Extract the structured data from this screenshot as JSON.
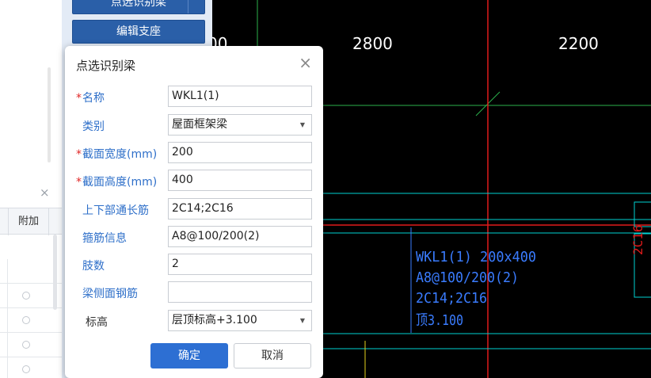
{
  "side_panel": {
    "top_button_label": "点选识别梁",
    "edit_support_label": "编辑支座"
  },
  "left_table": {
    "close_glyph": "×",
    "column_header": "附加"
  },
  "cad": {
    "dim_partial": "00",
    "dims": [
      "2800",
      "2200"
    ],
    "annotation_lines": [
      "WKL1(1) 200x400",
      "A8@100/200(2)",
      "2C14;2C16",
      "顶3.100"
    ],
    "vertical_text": "2C16"
  },
  "dialog": {
    "title": "点选识别梁",
    "close_glyph": "×",
    "required_mark": "*",
    "fields": {
      "name": {
        "label": "名称",
        "value": "WKL1(1)"
      },
      "category": {
        "label": "类别",
        "value": "屋面框架梁"
      },
      "width": {
        "label": "截面宽度(mm)",
        "value": "200"
      },
      "height": {
        "label": "截面高度(mm)",
        "value": "400"
      },
      "through_bar": {
        "label": "上下部通长筋",
        "value": "2C14;2C16"
      },
      "stirrup": {
        "label": "箍筋信息",
        "value": "A8@100/200(2)"
      },
      "legs": {
        "label": "肢数",
        "value": "2"
      },
      "side_bar": {
        "label": "梁侧面钢筋",
        "value": ""
      },
      "elevation": {
        "label": "标高",
        "value": "层顶标高+3.100"
      }
    },
    "ok_label": "确定",
    "cancel_label": "取消"
  },
  "colors": {
    "cad_bg": "#000000",
    "cyan": "#00d2d2",
    "red": "#e01a1a",
    "green": "#2bb24c",
    "blue_text": "#3a7cff",
    "primary": "#2d6fd3"
  }
}
